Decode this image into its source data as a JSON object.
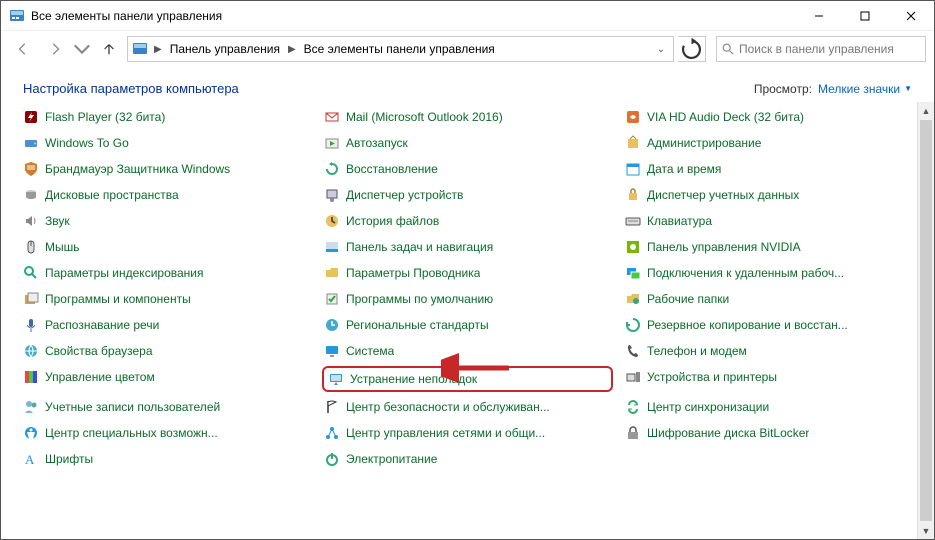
{
  "window": {
    "title": "Все элементы панели управления"
  },
  "nav": {
    "crumb1": "Панель управления",
    "crumb2": "Все элементы панели управления",
    "search_placeholder": "Поиск в панели управления"
  },
  "header": {
    "title": "Настройка параметров компьютера",
    "view_label": "Просмотр:",
    "view_value": "Мелкие значки"
  },
  "cols": {
    "c0": [
      {
        "l": "Flash Player (32 бита)",
        "i": "flash"
      },
      {
        "l": "Windows To Go",
        "i": "drive"
      },
      {
        "l": "Брандмауэр Защитника Windows",
        "i": "shield"
      },
      {
        "l": "Дисковые пространства",
        "i": "disk"
      },
      {
        "l": "Звук",
        "i": "sound"
      },
      {
        "l": "Мышь",
        "i": "mouse"
      },
      {
        "l": "Параметры индексирования",
        "i": "index"
      },
      {
        "l": "Программы и компоненты",
        "i": "programs"
      },
      {
        "l": "Распознавание речи",
        "i": "speech"
      },
      {
        "l": "Свойства браузера",
        "i": "globe"
      },
      {
        "l": "Управление цветом",
        "i": "color"
      },
      {
        "l": "Учетные записи пользователей",
        "i": "users"
      },
      {
        "l": "Центр специальных возможн...",
        "i": "ease"
      },
      {
        "l": "Шрифты",
        "i": "fonts"
      }
    ],
    "c1": [
      {
        "l": "Mail (Microsoft Outlook 2016)",
        "i": "mail"
      },
      {
        "l": "Автозапуск",
        "i": "autoplay"
      },
      {
        "l": "Восстановление",
        "i": "recovery"
      },
      {
        "l": "Диспетчер устройств",
        "i": "devmgr"
      },
      {
        "l": "История файлов",
        "i": "history"
      },
      {
        "l": "Панель задач и навигация",
        "i": "taskbar"
      },
      {
        "l": "Параметры Проводника",
        "i": "folder"
      },
      {
        "l": "Программы по умолчанию",
        "i": "defaults"
      },
      {
        "l": "Региональные стандарты",
        "i": "region"
      },
      {
        "l": "Система",
        "i": "system"
      },
      {
        "l": "Устранение неполадок",
        "i": "troubleshoot",
        "hl": true
      },
      {
        "l": "Центр безопасности и обслуживан...",
        "i": "flag"
      },
      {
        "l": "Центр управления сетями и общи...",
        "i": "network"
      },
      {
        "l": "Электропитание",
        "i": "power"
      }
    ],
    "c2": [
      {
        "l": "VIA HD Audio Deck (32 бита)",
        "i": "audio"
      },
      {
        "l": "Администрирование",
        "i": "admin"
      },
      {
        "l": "Дата и время",
        "i": "date"
      },
      {
        "l": "Диспетчер учетных данных",
        "i": "cred"
      },
      {
        "l": "Клавиатура",
        "i": "keyboard"
      },
      {
        "l": "Панель управления NVIDIA",
        "i": "nvidia"
      },
      {
        "l": "Подключения к удаленным рабоч...",
        "i": "remote"
      },
      {
        "l": "Рабочие папки",
        "i": "workfolder"
      },
      {
        "l": "Резервное копирование и восстан...",
        "i": "backup"
      },
      {
        "l": "Телефон и модем",
        "i": "phone"
      },
      {
        "l": "Устройства и принтеры",
        "i": "devices"
      },
      {
        "l": "Центр синхронизации",
        "i": "sync"
      },
      {
        "l": "Шифрование диска BitLocker",
        "i": "bitlocker"
      }
    ]
  }
}
